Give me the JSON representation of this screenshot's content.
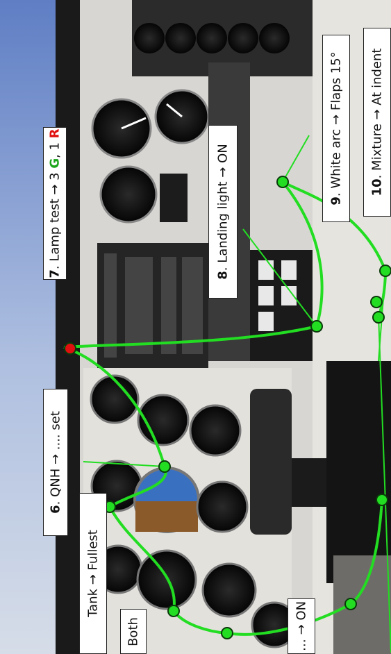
{
  "labels": {
    "tank": "Tank → Fullest",
    "both": "Both",
    "qnh_num": "6",
    "qnh": ". QNH → .... set",
    "lamp_num": "7",
    "lamp_text": ". Lamp test → 3 ",
    "lamp_g": "G",
    "lamp_sep": ", 1 ",
    "lamp_r": "R",
    "landing_num": "8",
    "landing": ". Landing light → ON",
    "whitearc_num": "9",
    "whitearc": ". White arc → Flaps 15°",
    "mixture_num": "10",
    "mixture": ". Mixture → At indent",
    "on_partial": "… → ON"
  },
  "colors": {
    "connector": "#22dd22",
    "node_fill": "#22dd22",
    "node_stroke": "#0a3a0a",
    "lamp_green": "#1aa51a",
    "lamp_red": "#e01010"
  }
}
